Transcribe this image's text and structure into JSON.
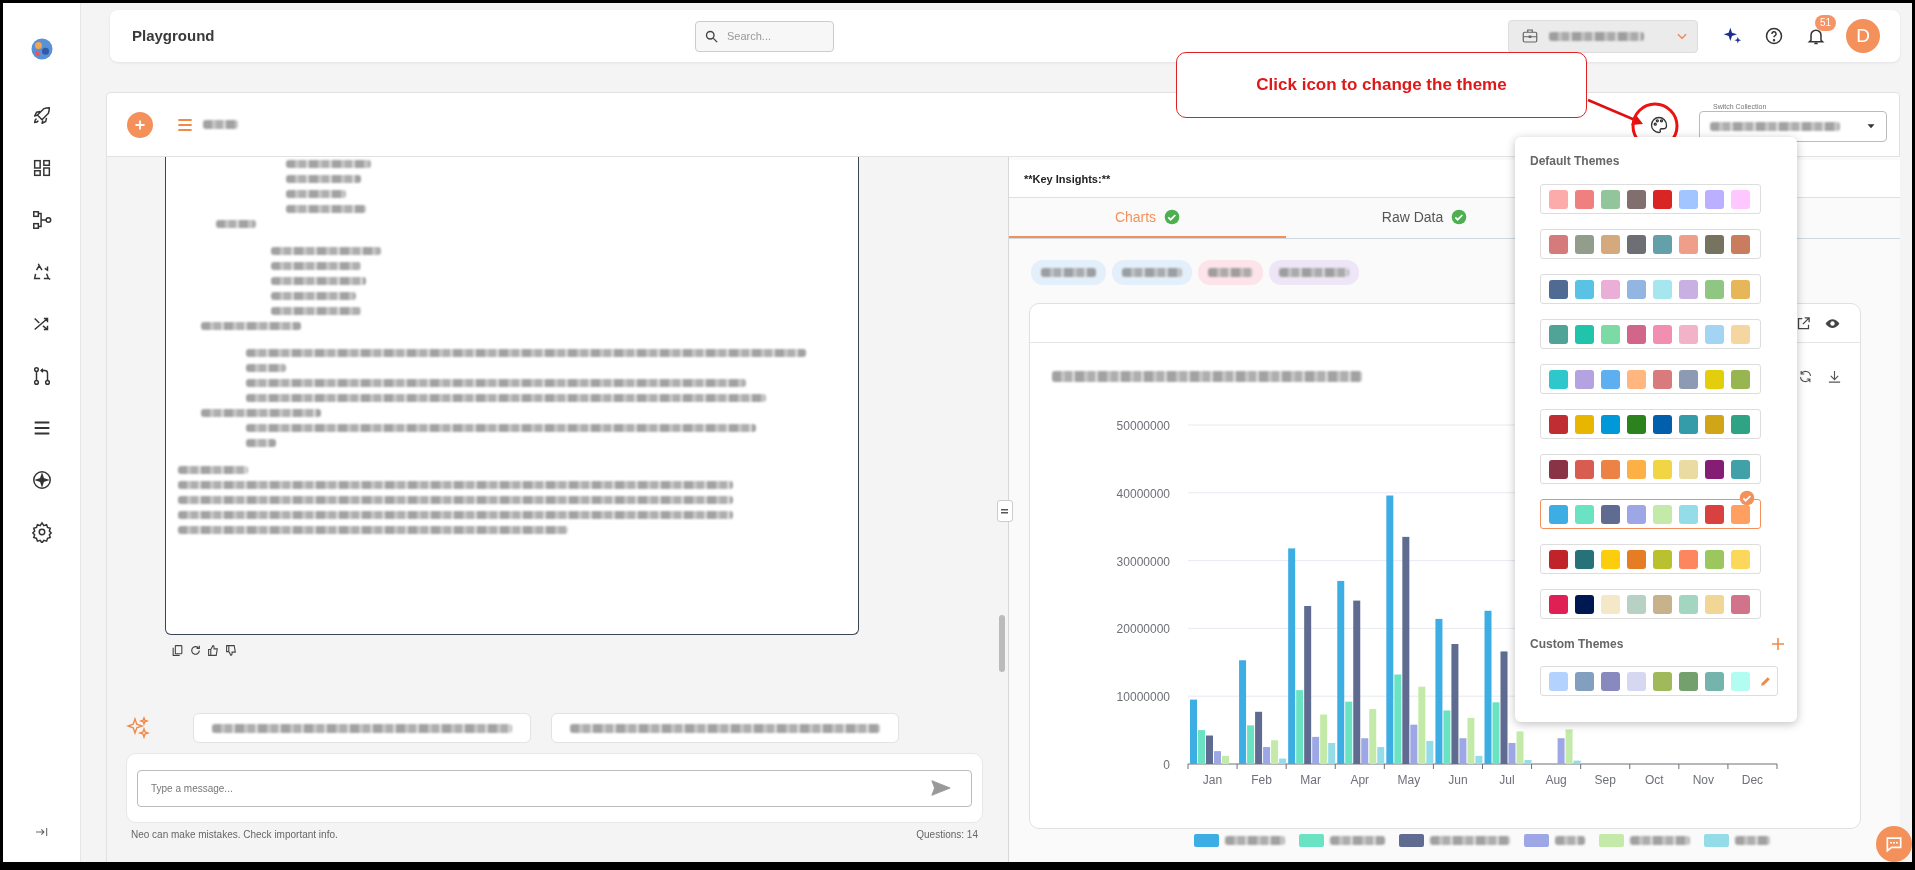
{
  "header": {
    "title": "Playground",
    "search": {
      "placeholder": "Search..."
    },
    "notifications": "51",
    "avatar": "D"
  },
  "toolbar": {
    "switch_collection": {
      "label": "Switch Collection"
    }
  },
  "callout": {
    "text": "Click icon to change the theme"
  },
  "chat": {
    "input": {
      "placeholder": "Type a message..."
    },
    "disclaimer": "Neo can make mistakes. Check important info.",
    "question_count": "Questions: 14"
  },
  "insights": {
    "heading": "**Key Insights:**",
    "tabs": [
      {
        "label": "Charts",
        "selected": true,
        "done": true
      },
      {
        "label": "Raw Data",
        "selected": false,
        "done": true
      }
    ],
    "chart_data": {
      "type": "bar",
      "grid": true,
      "categories": [
        "Jan",
        "Feb",
        "Mar",
        "Apr",
        "May",
        "Jun",
        "Jul",
        "Aug",
        "Sep",
        "Oct",
        "Nov",
        "Dec"
      ],
      "ylim": [
        0,
        50000000
      ],
      "yticks": [
        0,
        10000000,
        20000000,
        30000000,
        40000000,
        50000000
      ],
      "series": [
        {
          "color": "#3daee3",
          "values": [
            9500000,
            15300000,
            31800000,
            27000000,
            39600000,
            21400000,
            22600000,
            null,
            null,
            null,
            null,
            null
          ]
        },
        {
          "color": "#6ae3c3",
          "values": [
            5000000,
            5700000,
            10900000,
            9200000,
            13200000,
            7900000,
            9100000,
            null,
            null,
            null,
            null,
            null
          ]
        },
        {
          "color": "#5f6b90",
          "values": [
            4200000,
            7700000,
            23300000,
            24100000,
            33500000,
            17700000,
            16600000,
            null,
            null,
            null,
            null,
            null
          ]
        },
        {
          "color": "#9ea7e6",
          "values": [
            1900000,
            2500000,
            4000000,
            3800000,
            5800000,
            3800000,
            3100000,
            3800000,
            null,
            null,
            null,
            null
          ]
        },
        {
          "color": "#c3eaa8",
          "values": [
            1200000,
            3500000,
            7300000,
            8100000,
            11400000,
            6800000,
            4800000,
            5100000,
            null,
            null,
            null,
            null
          ]
        },
        {
          "color": "#93dce8",
          "values": [
            0,
            800000,
            3100000,
            2500000,
            3400000,
            1200000,
            600000,
            500000,
            null,
            null,
            null,
            null
          ]
        }
      ]
    }
  },
  "theme_menu": {
    "default_title": "Default Themes",
    "default_themes": [
      {
        "selected": false,
        "swatches": [
          {
            "color": "#fdaaaa"
          },
          {
            "color": "#f08080"
          },
          {
            "color": "#93c59a"
          },
          {
            "color": "#816e6e"
          },
          {
            "color": "#da2525"
          },
          {
            "color": "#a2c4ff"
          },
          {
            "color": "#bbb0ff"
          },
          {
            "color": "#ffc7ff"
          }
        ]
      },
      {
        "selected": false,
        "swatches": [
          {
            "color": "#d67b7b"
          },
          {
            "color": "#929e8b"
          },
          {
            "color": "#d4a97e"
          },
          {
            "color": "#6e6f74"
          },
          {
            "color": "#63a0aa"
          },
          {
            "color": "#ef9f89"
          },
          {
            "color": "#767360"
          },
          {
            "color": "#ca7c5f"
          }
        ]
      },
      {
        "selected": false,
        "swatches": [
          {
            "color": "#4f6a93"
          },
          {
            "color": "#5ac3e5"
          },
          {
            "color": "#ebaed6"
          },
          {
            "color": "#92b5e2"
          },
          {
            "color": "#a6e6ef"
          },
          {
            "color": "#c8b0e2"
          },
          {
            "color": "#8fc682"
          },
          {
            "color": "#e6b658"
          }
        ]
      },
      {
        "selected": false,
        "swatches": [
          {
            "color": "#4fa397"
          },
          {
            "color": "#20c4aa"
          },
          {
            "color": "#7cdaa5"
          },
          {
            "color": "#d2658a"
          },
          {
            "color": "#f18eb1"
          },
          {
            "color": "#f2b3c8"
          },
          {
            "color": "#a4d4f4"
          },
          {
            "color": "#f5d6a0"
          }
        ]
      },
      {
        "selected": false,
        "swatches": [
          {
            "color": "#2ec8cc"
          },
          {
            "color": "#b5a2e0"
          },
          {
            "color": "#5daff0"
          },
          {
            "color": "#ffb77f"
          },
          {
            "color": "#d97a7d"
          },
          {
            "color": "#8c9ab4"
          },
          {
            "color": "#e4cd0c"
          },
          {
            "color": "#97b550"
          }
        ]
      },
      {
        "selected": false,
        "swatches": [
          {
            "color": "#c02d33"
          },
          {
            "color": "#e8b600"
          },
          {
            "color": "#0098d9"
          },
          {
            "color": "#2c821c"
          },
          {
            "color": "#025fab"
          },
          {
            "color": "#349ca9"
          },
          {
            "color": "#d0a618"
          },
          {
            "color": "#30a385"
          }
        ]
      },
      {
        "selected": false,
        "swatches": [
          {
            "color": "#8b3346"
          },
          {
            "color": "#d85c50"
          },
          {
            "color": "#ec8245"
          },
          {
            "color": "#fdb045"
          },
          {
            "color": "#f2d544"
          },
          {
            "color": "#eadba1"
          },
          {
            "color": "#861d74"
          },
          {
            "color": "#41a0a8"
          }
        ]
      },
      {
        "selected": true,
        "swatches": [
          {
            "color": "#3daee3"
          },
          {
            "color": "#6ae3c3"
          },
          {
            "color": "#5f6b90"
          },
          {
            "color": "#9ea7e6"
          },
          {
            "color": "#c3eaa8"
          },
          {
            "color": "#93dce8"
          },
          {
            "color": "#d94040"
          },
          {
            "color": "#ff9f60"
          }
        ]
      },
      {
        "selected": false,
        "swatches": [
          {
            "color": "#c0232a"
          },
          {
            "color": "#277178"
          },
          {
            "color": "#fbcd0c"
          },
          {
            "color": "#e67c23"
          },
          {
            "color": "#b9c22e"
          },
          {
            "color": "#fd865f"
          },
          {
            "color": "#9bc75e"
          },
          {
            "color": "#fbd75c"
          }
        ]
      },
      {
        "selected": false,
        "swatches": [
          {
            "color": "#e01f54"
          },
          {
            "color": "#001851"
          },
          {
            "color": "#f5e8c8"
          },
          {
            "color": "#b7d2c4"
          },
          {
            "color": "#c7b28b"
          },
          {
            "color": "#a2d6c1"
          },
          {
            "color": "#f0d795"
          },
          {
            "color": "#d1738b"
          }
        ]
      }
    ],
    "custom_title": "Custom Themes",
    "custom_themes": [
      {
        "swatches": [
          {
            "color": "#b3d3fe"
          },
          {
            "color": "#839fbf"
          },
          {
            "color": "#8789bf"
          },
          {
            "color": "#d6d7f1"
          },
          {
            "color": "#a0ba5b"
          },
          {
            "color": "#74a06e"
          },
          {
            "color": "#75b4ad"
          },
          {
            "color": "#b2fcf1"
          }
        ]
      }
    ]
  }
}
